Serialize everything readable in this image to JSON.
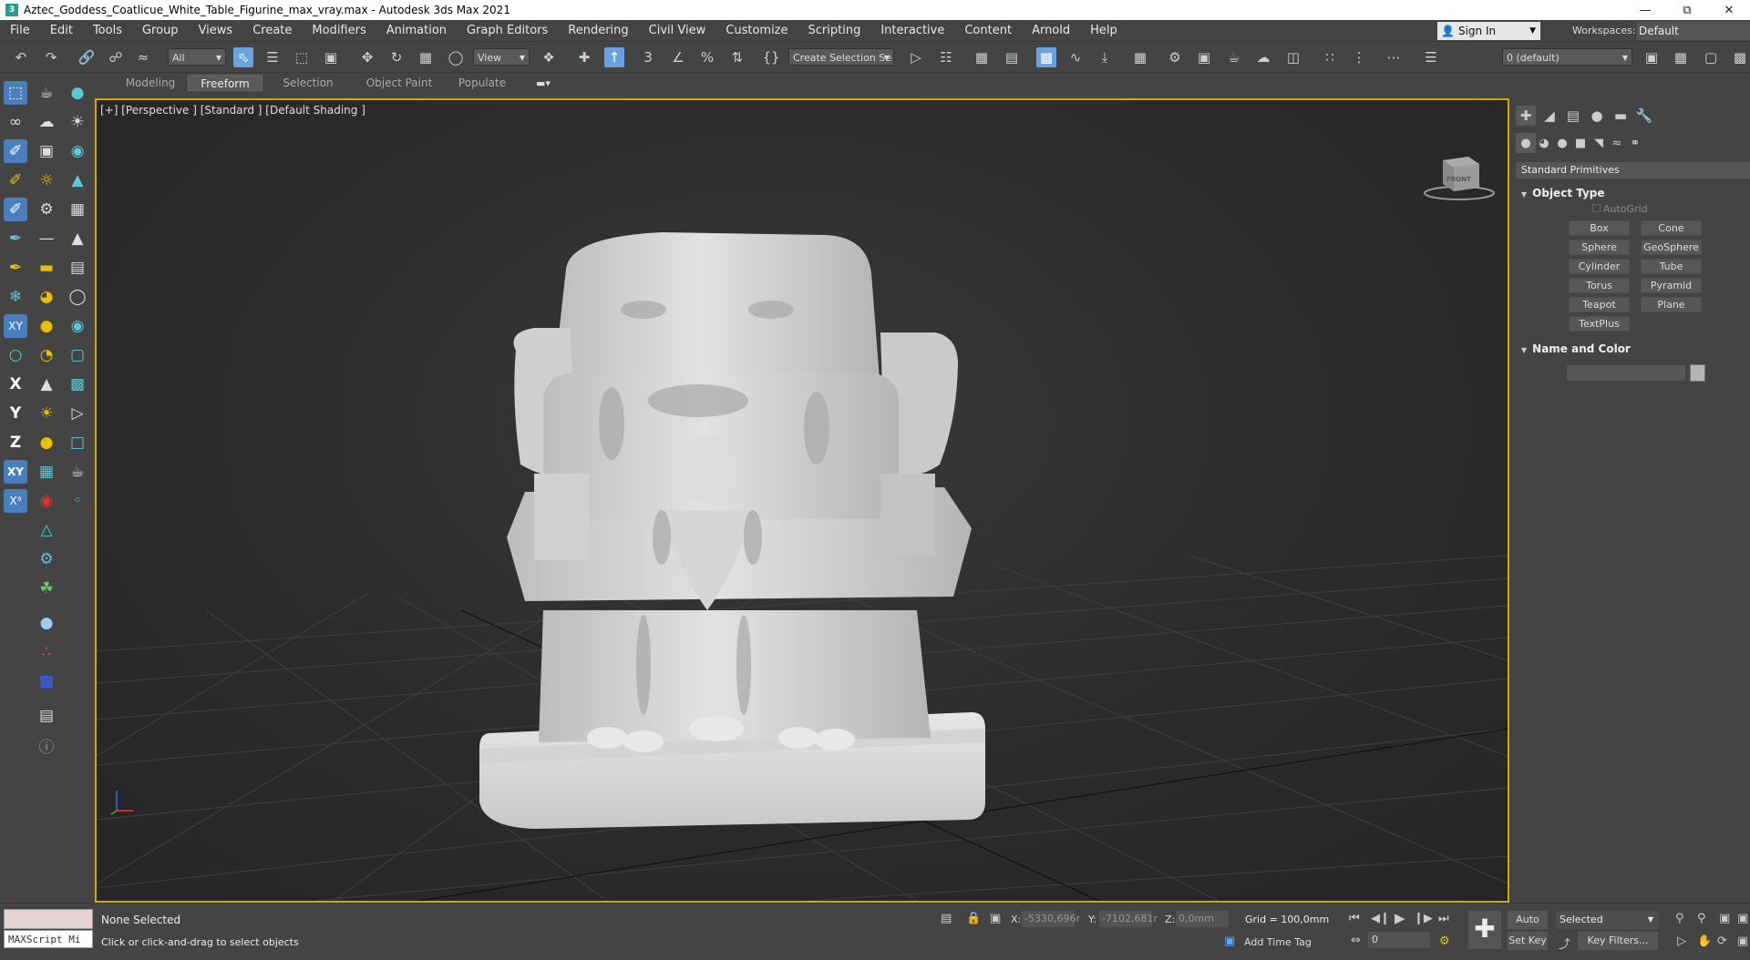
{
  "window": {
    "title": "Aztec_Goddess_Coatlicue_White_Table_Figurine_max_vray.max - Autodesk 3ds Max 2021",
    "app_icon": "3"
  },
  "menu": [
    "File",
    "Edit",
    "Tools",
    "Group",
    "Views",
    "Create",
    "Modifiers",
    "Animation",
    "Graph Editors",
    "Rendering",
    "Civil View",
    "Customize",
    "Scripting",
    "Interactive",
    "Content",
    "Arnold",
    "Help"
  ],
  "account": {
    "sign_in": "Sign In",
    "workspaces_label": "Workspaces:",
    "workspace": "Default"
  },
  "toolbar": {
    "selection_filter": "All",
    "ref_coord": "View",
    "named_selection": "Create Selection Se",
    "layer": "0 (default)"
  },
  "ribbon_tabs": [
    "Modeling",
    "Freeform",
    "Selection",
    "Object Paint",
    "Populate"
  ],
  "viewport": {
    "label": "[+] [Perspective ] [Standard ] [Default Shading ]",
    "viewcube_label": "FRONT"
  },
  "command_panel": {
    "category": "Standard Primitives",
    "object_type_title": "Object Type",
    "autogrid": "AutoGrid",
    "buttons": [
      "Box",
      "Cone",
      "Sphere",
      "GeoSphere",
      "Cylinder",
      "Tube",
      "Torus",
      "Pyramid",
      "Teapot",
      "Plane",
      "TextPlus"
    ],
    "name_color_title": "Name and Color",
    "object_color": "#b3b3b3"
  },
  "status": {
    "maxscript": "MAXScript Mi",
    "selection": "None Selected",
    "hint": "Click or click-and-drag to select objects",
    "x_label": "X:",
    "x_value": "-5330,696r",
    "y_label": "Y:",
    "y_value": "-7102,681r",
    "z_label": "Z:",
    "z_value": "0,0mm",
    "grid": "Grid = 100,0mm",
    "add_time_tag": "Add Time Tag",
    "frame": "0",
    "auto_key": "Auto K...",
    "set_key": "Set Key",
    "key_mode": "Selected",
    "key_filters": "Key Filters..."
  },
  "axis": {
    "x": "X",
    "y": "Y",
    "z": "Z",
    "xy": "XY",
    "xy2": "XY"
  },
  "colors": {
    "accent": "#6aa2dd",
    "viewport_border": "#d4a800",
    "model": "#d8d8d8"
  }
}
